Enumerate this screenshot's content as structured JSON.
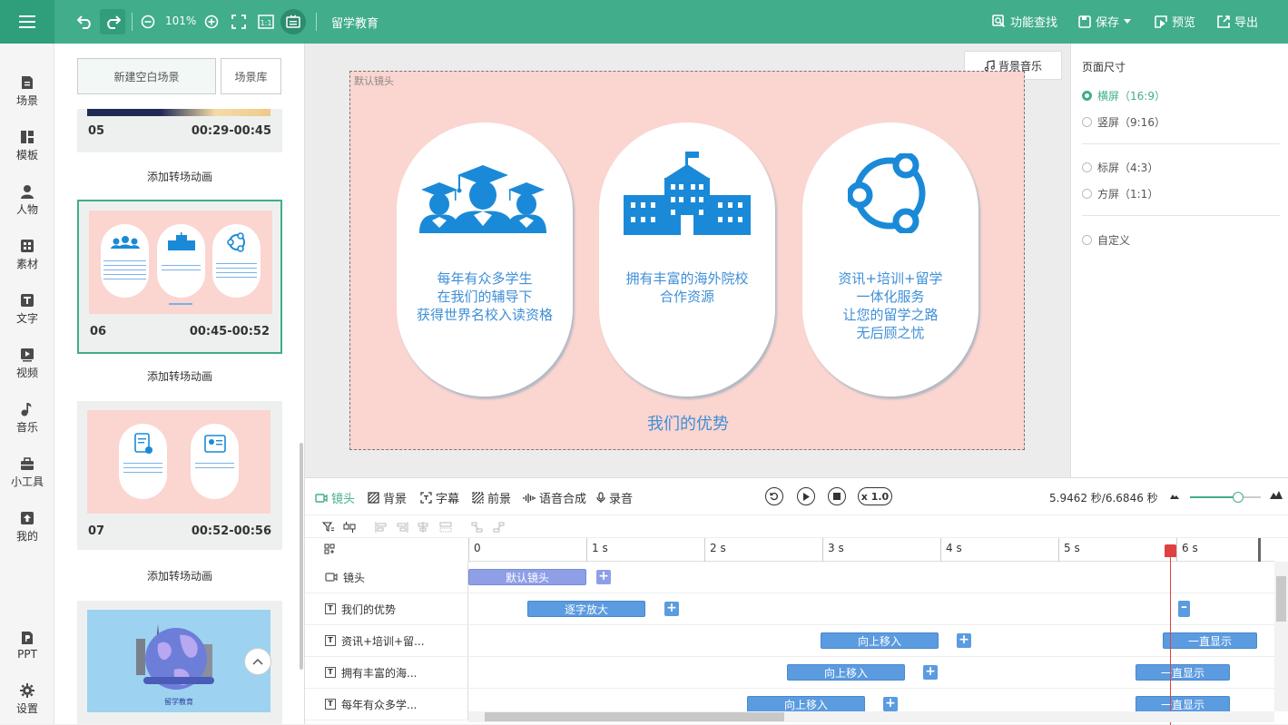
{
  "toolbar": {
    "zoom": "101%",
    "project_title": "留学教育",
    "find_label": "功能查找",
    "save_label": "保存",
    "preview_label": "预览",
    "export_label": "导出"
  },
  "nav": [
    {
      "label": "场景",
      "icon": "scene-icon"
    },
    {
      "label": "模板",
      "icon": "template-icon"
    },
    {
      "label": "人物",
      "icon": "person-icon"
    },
    {
      "label": "素材",
      "icon": "material-icon"
    },
    {
      "label": "文字",
      "icon": "text-icon"
    },
    {
      "label": "视频",
      "icon": "video-icon"
    },
    {
      "label": "音乐",
      "icon": "music-icon"
    },
    {
      "label": "小工具",
      "icon": "toolbox-icon"
    },
    {
      "label": "我的",
      "icon": "upload-icon"
    },
    {
      "label": "PPT",
      "icon": "ppt-icon"
    },
    {
      "label": "设置",
      "icon": "gear-icon"
    }
  ],
  "scenes_panel": {
    "new_blank": "新建空白场景",
    "library": "场景库",
    "transition_label": "添加转场动画",
    "scenes": [
      {
        "num": "05",
        "time": "00:29-00:45"
      },
      {
        "num": "06",
        "time": "00:45-00:52"
      },
      {
        "num": "07",
        "time": "00:52-00:56"
      }
    ],
    "thumb8_caption": "留学教育"
  },
  "canvas": {
    "bg_music": "背景音乐",
    "frame_label": "默认镜头",
    "pill1": "每年有众多学生\n在我们的辅导下\n获得世界名校入读资格",
    "pill2": "拥有丰富的海外院校\n合作资源",
    "pill3": "资讯+培训+留学\n一体化服务\n让您的留学之路\n无后顾之忧",
    "title": "我们的优势",
    "colors": {
      "stage_bg": "#fbd5d0",
      "text_blue": "#3f8fd6",
      "icon_blue": "#1a8ad8",
      "accent": "#41ad8a"
    }
  },
  "props": {
    "title": "页面尺寸",
    "options": [
      {
        "label": "横屏（16:9）",
        "selected": true
      },
      {
        "label": "竖屏（9:16）",
        "selected": false
      },
      {
        "label": "标屏（4:3）",
        "selected": false
      },
      {
        "label": "方屏（1:1）",
        "selected": false
      },
      {
        "label": "自定义",
        "selected": false
      }
    ]
  },
  "timeline": {
    "tabs": [
      "镜头",
      "背景",
      "字幕",
      "前景",
      "语音合成",
      "录音"
    ],
    "speed": "x 1.0",
    "time": "5.9462 秒/6.6846 秒",
    "ruler": [
      "0",
      "1 s",
      "2 s",
      "3 s",
      "4 s",
      "5 s",
      "6 s"
    ],
    "tracks": [
      {
        "name": "镜头",
        "blocks": [
          "默认镜头"
        ]
      },
      {
        "name": "我们的优势",
        "blocks": [
          "逐字放大"
        ]
      },
      {
        "name": "资讯+培训+留...",
        "blocks": [
          "向上移入",
          "一直显示"
        ]
      },
      {
        "name": "拥有丰富的海...",
        "blocks": [
          "向上移入",
          "一直显示"
        ]
      },
      {
        "name": "每年有众多学...",
        "blocks": [
          "向上移入",
          "一直显示"
        ]
      }
    ],
    "playhead_seconds": 5.9462,
    "total_seconds": 6.6846
  }
}
